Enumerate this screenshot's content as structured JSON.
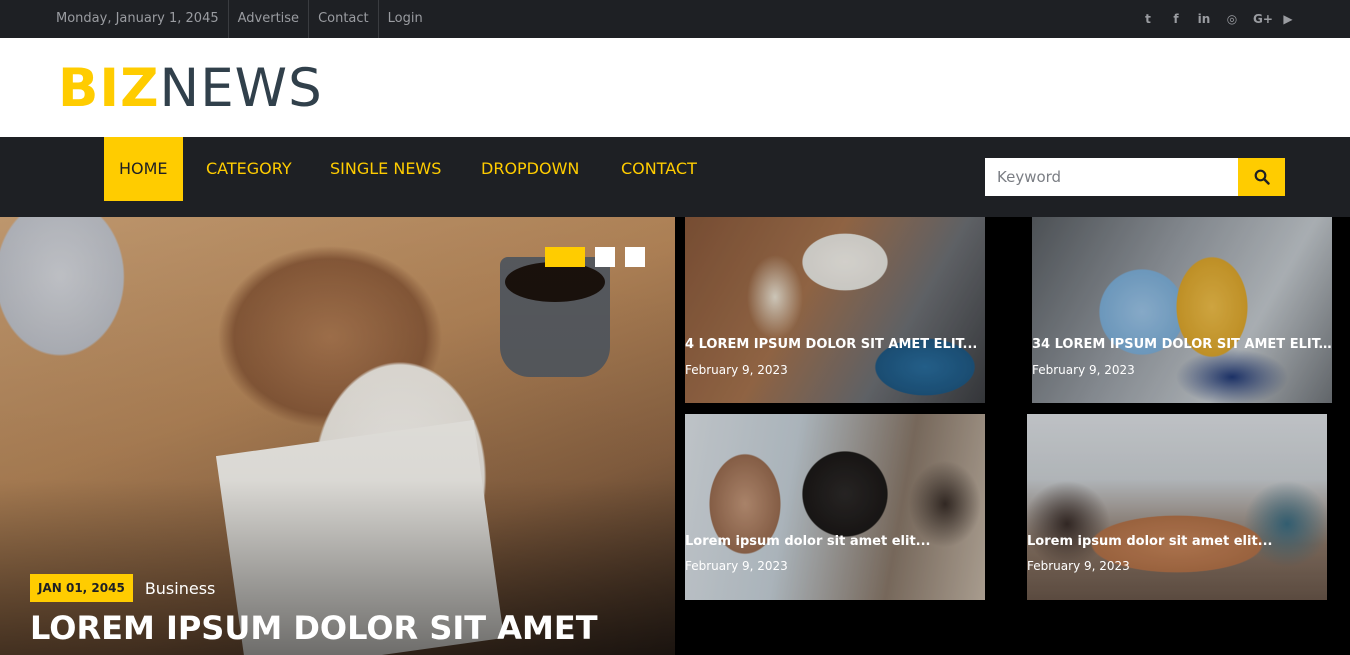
{
  "topbar": {
    "date": "Monday, January 1, 2045",
    "links": [
      "Advertise",
      "Contact",
      "Login"
    ],
    "social_icons": [
      "twitter-icon",
      "facebook-icon",
      "linkedin-icon",
      "instagram-icon",
      "google-plus-icon",
      "youtube-icon"
    ],
    "social_glyphs": [
      "t",
      "f",
      "in",
      "◎",
      "G+",
      "▶"
    ]
  },
  "logo": {
    "part1": "BIZ",
    "part2": "NEWS"
  },
  "nav": {
    "items": [
      "HOME",
      "CATEGORY",
      "SINGLE NEWS",
      "DROPDOWN",
      "CONTACT"
    ],
    "active": "HOME",
    "search_placeholder": "Keyword"
  },
  "hero": {
    "date_badge": "JAN 01, 2045",
    "category": "Business",
    "title": "LOREM IPSUM DOLOR SIT AMET"
  },
  "tiles": [
    {
      "title": "4 LOREM IPSUM DOLOR SIT AMET ELIT...",
      "date": "February 9, 2023"
    },
    {
      "title": "34 LOREM IPSUM DOLOR SIT AMET ELIT...",
      "date": "February 9, 2023"
    },
    {
      "title": "Lorem ipsum dolor sit amet elit...",
      "date": "February 9, 2023"
    },
    {
      "title": "Lorem ipsum dolor sit amet elit...",
      "date": "February 9, 2023"
    }
  ],
  "colors": {
    "accent": "#ffcc00",
    "dark": "#1e2024",
    "logo_dark": "#31404b"
  }
}
